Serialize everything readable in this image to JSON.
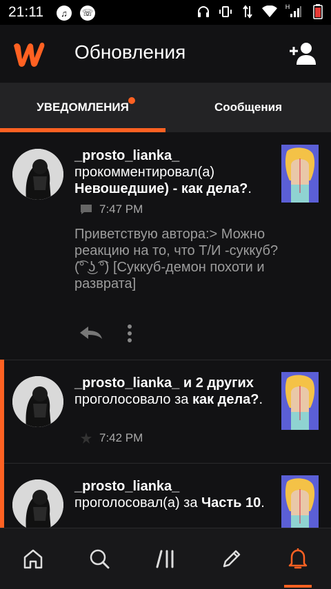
{
  "status_bar": {
    "time": "21:11",
    "network_label": "H"
  },
  "header": {
    "title": "Обновления"
  },
  "tabs": [
    {
      "label": "УВЕДОМЛЕНИЯ",
      "active": true,
      "has_badge": true
    },
    {
      "label": "Сообщения",
      "active": false
    }
  ],
  "notifications": [
    {
      "user": "_prosto_lianka_",
      "action": "прокомментировал(а)",
      "target": "Невошедшие) - как дела?",
      "suffix": ".",
      "time": "7:47 PM",
      "icon": "comment-icon",
      "comment": "Приветствую автора:> Можно реакцию на то, что Т/И -суккуб?(͡° ͜ʖ ͡°) [Суккуб-демон похоти и разврата]"
    },
    {
      "user": "_prosto_lianka_",
      "others": " и 2 других",
      "action": "проголосовало за",
      "target": "как дела?",
      "suffix": ".",
      "time": "7:42 PM",
      "icon": "star-icon"
    },
    {
      "user": "_prosto_lianka_",
      "action": "проголосовал(а) за",
      "target": "Часть 10",
      "suffix": "."
    }
  ],
  "colors": {
    "accent": "#ff6122",
    "background": "#121214",
    "tab_bar": "#232325"
  },
  "bottom_nav": [
    "home-icon",
    "search-icon",
    "library-icon",
    "write-icon",
    "notifications-icon"
  ]
}
